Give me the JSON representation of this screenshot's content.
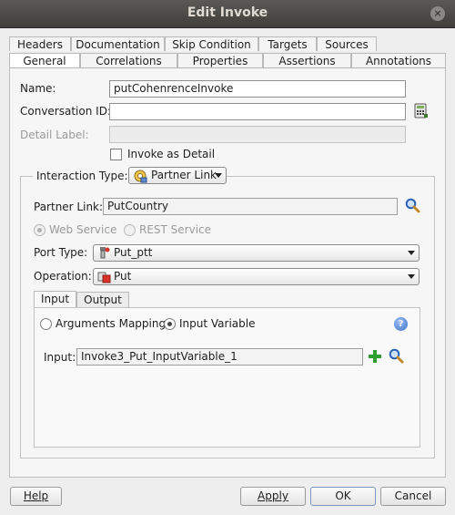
{
  "window": {
    "title": "Edit Invoke",
    "close_glyph": "×"
  },
  "tabs_row1": [
    {
      "label": "Headers"
    },
    {
      "label": "Documentation"
    },
    {
      "label": "Skip Condition"
    },
    {
      "label": "Targets"
    },
    {
      "label": "Sources"
    }
  ],
  "tabs_row2": [
    {
      "label": "General",
      "selected": true
    },
    {
      "label": "Correlations"
    },
    {
      "label": "Properties"
    },
    {
      "label": "Assertions"
    },
    {
      "label": "Annotations"
    }
  ],
  "general": {
    "name_label": "Name:",
    "name_value": "putCohenrenceInvoke",
    "conversation_label": "Conversation ID:",
    "conversation_value": "",
    "detail_label_label": "Detail Label:",
    "detail_label_value": "",
    "invoke_as_detail_label": "Invoke as Detail",
    "invoke_as_detail_checked": false
  },
  "interaction": {
    "label": "Interaction Type:",
    "type_value": "Partner Link",
    "partner_link_label": "Partner Link:",
    "partner_link_value": "PutCountry",
    "web_service_label": "Web Service",
    "rest_service_label": "REST Service",
    "port_type_label": "Port Type:",
    "port_type_value": "Put_ptt",
    "operation_label": "Operation:",
    "operation_value": "Put"
  },
  "io_tabs": [
    {
      "label": "Input",
      "selected": true
    },
    {
      "label": "Output"
    }
  ],
  "input": {
    "arguments_mapping_label": "Arguments Mapping",
    "input_variable_label": "Input Variable",
    "selected_mode": "Input Variable",
    "input_label": "Input:",
    "input_value": "Invoke3_Put_InputVariable_1",
    "help_glyph": "?"
  },
  "buttons": {
    "help": "Help",
    "apply": "Apply",
    "ok": "OK",
    "cancel": "Cancel"
  },
  "colors": {
    "title_bar": "#4b4a46",
    "add_icon": "#2ea02e",
    "search_icon": "#2b63b6",
    "help_icon": "#3b72c8"
  }
}
